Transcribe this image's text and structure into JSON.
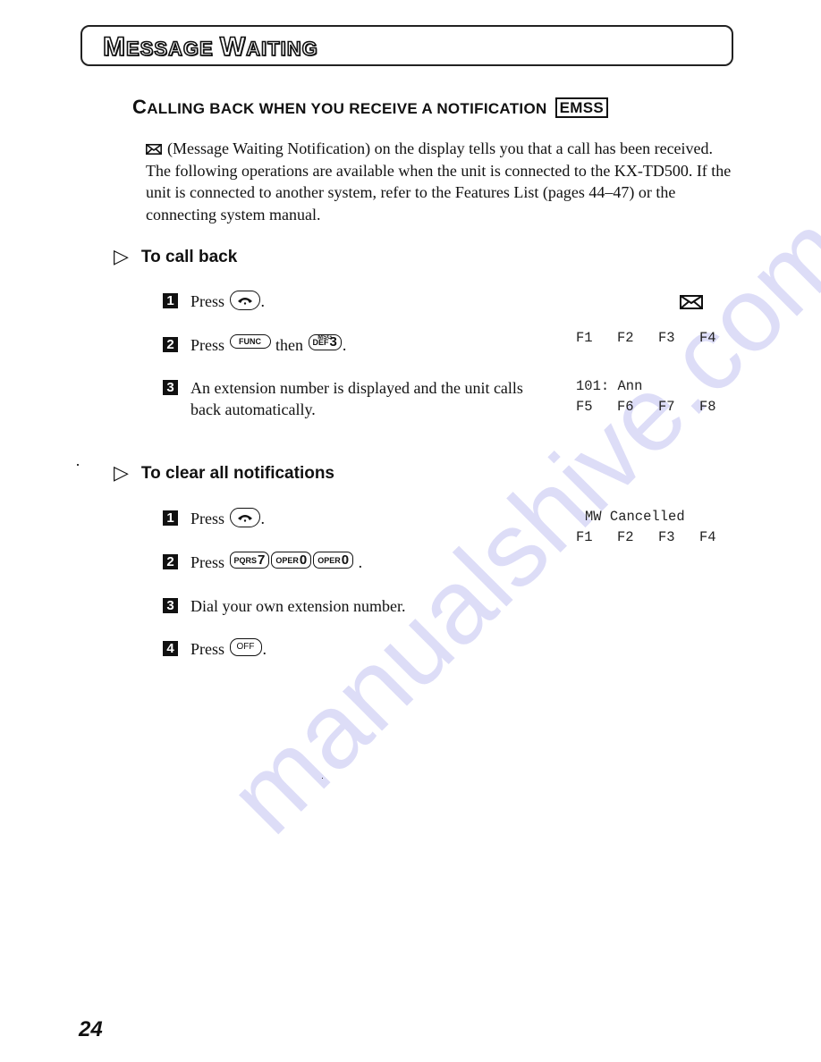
{
  "banner": {
    "title_parts": [
      {
        "cap": "M",
        "rest": "ESSAGE "
      },
      {
        "cap": "W",
        "rest": "AITING"
      }
    ]
  },
  "section": {
    "heading_cap": "C",
    "heading_rest": "ALLING BACK WHEN YOU RECEIVE A NOTIFICATION",
    "badge": "EMSS"
  },
  "intro": {
    "icon": "envelope-icon",
    "text": "(Message Waiting Notification) on the display tells you that a call has been received. The following operations are available when the unit is connected to the KX-TD500. If the unit is connected to another system, refer to the Features List (pages 44–47) or the connecting system manual."
  },
  "call_back": {
    "title": "To call back",
    "steps": [
      {
        "num": "1",
        "press": "Press",
        "suffix": "."
      },
      {
        "num": "2",
        "press": "Press",
        "key_func": "FUNC",
        "then": "then",
        "key_msg_top": "MSG",
        "key_def": "DEF",
        "key_digit": "3",
        "suffix": "."
      },
      {
        "num": "3",
        "text": "An extension number is displayed and the unit calls back automatically."
      }
    ],
    "display": {
      "icon": "envelope-icon",
      "row1": [
        "F1",
        "F2",
        "F3",
        "F4"
      ],
      "line_ext": "101: Ann",
      "row2": [
        "F5",
        "F6",
        "F7",
        "F8"
      ]
    }
  },
  "clear_all": {
    "title": "To clear all notifications",
    "steps": [
      {
        "num": "1",
        "press": "Press",
        "suffix": "."
      },
      {
        "num": "2",
        "press": "Press",
        "keys": [
          {
            "label": "PQRS",
            "digit": "7"
          },
          {
            "label": "OPER",
            "digit": "0"
          },
          {
            "label": "OPER",
            "digit": "0"
          }
        ],
        "suffix": "."
      },
      {
        "num": "3",
        "text": "Dial your own extension number."
      },
      {
        "num": "4",
        "press": "Press",
        "key_off": "OFF",
        "suffix": "."
      }
    ],
    "display": {
      "line": "MW Cancelled",
      "row1": [
        "F1",
        "F2",
        "F3",
        "F4"
      ]
    }
  },
  "page_number": "24",
  "watermark": "manualshive.com"
}
